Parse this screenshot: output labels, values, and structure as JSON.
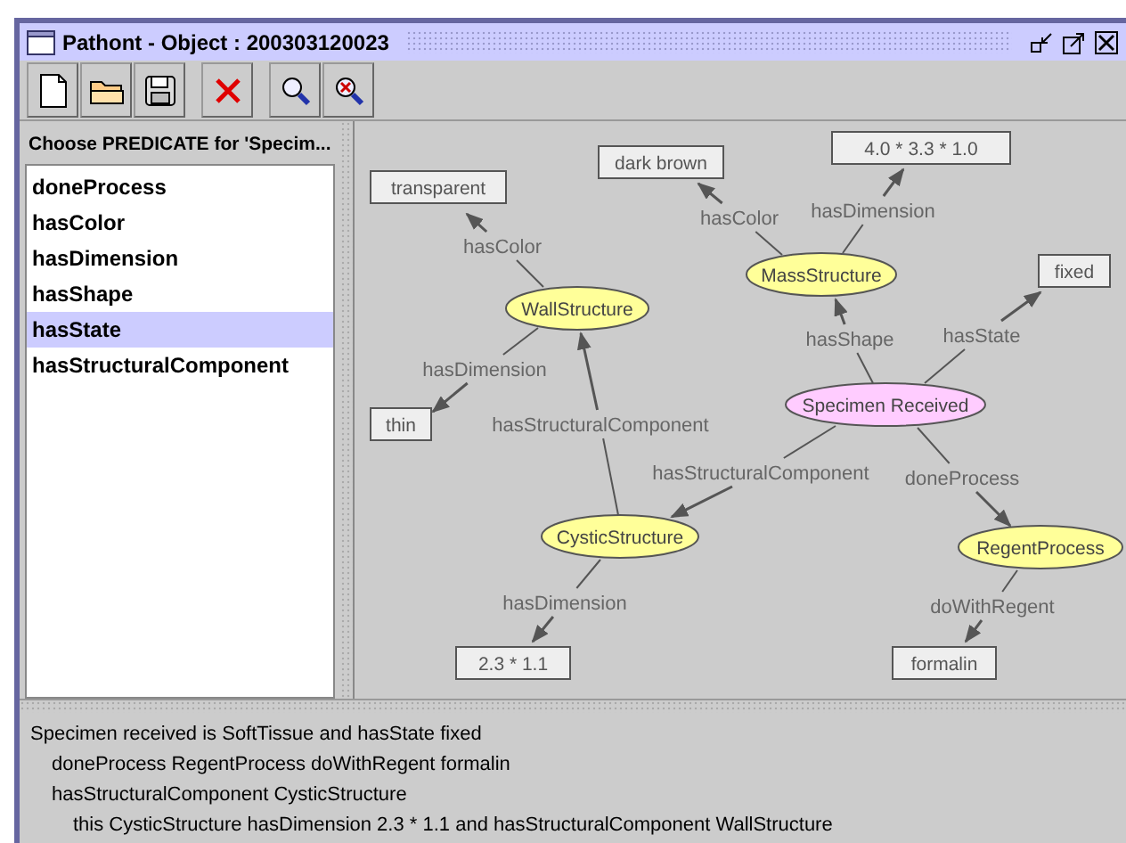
{
  "window": {
    "title": "Pathont - Object : 200303120023"
  },
  "predicates": {
    "heading": "Choose PREDICATE for 'Specim...",
    "items": [
      {
        "label": "doneProcess",
        "selected": false
      },
      {
        "label": "hasColor",
        "selected": false
      },
      {
        "label": "hasDimension",
        "selected": false
      },
      {
        "label": "hasShape",
        "selected": false
      },
      {
        "label": "hasState",
        "selected": true
      },
      {
        "label": "hasStructuralComponent",
        "selected": false
      }
    ]
  },
  "graph": {
    "nodes": [
      {
        "label": "transparent",
        "kind": "value"
      },
      {
        "label": "dark brown",
        "kind": "value"
      },
      {
        "label": "4.0 * 3.3 * 1.0",
        "kind": "value"
      },
      {
        "label": "fixed",
        "kind": "value"
      },
      {
        "label": "thin",
        "kind": "value"
      },
      {
        "label": "2.3 * 1.1",
        "kind": "value"
      },
      {
        "label": "formalin",
        "kind": "value"
      },
      {
        "label": "WallStructure",
        "kind": "class"
      },
      {
        "label": "MassStructure",
        "kind": "class"
      },
      {
        "label": "Specimen Received",
        "kind": "focus"
      },
      {
        "label": "CysticStructure",
        "kind": "class"
      },
      {
        "label": "RegentProcess",
        "kind": "class"
      }
    ],
    "edges": [
      {
        "label": "hasColor"
      },
      {
        "label": "hasDimension"
      },
      {
        "label": "hasStructuralComponent"
      },
      {
        "label": "hasColor"
      },
      {
        "label": "hasDimension"
      },
      {
        "label": "hasShape"
      },
      {
        "label": "hasState"
      },
      {
        "label": "hasStructuralComponent"
      },
      {
        "label": "doneProcess"
      },
      {
        "label": "hasDimension"
      },
      {
        "label": "doWithRegent"
      }
    ]
  },
  "description": [
    {
      "text": "Specimen received is SoftTissue and hasState fixed",
      "children": [
        {
          "text": "doneProcess RegentProcess doWithRegent formalin"
        },
        {
          "text": "hasStructuralComponent CysticStructure",
          "children": [
            {
              "text": "this CysticStructure hasDimension 2.3 * 1.1 and hasStructuralComponent WallStructure"
            }
          ]
        }
      ]
    }
  ]
}
